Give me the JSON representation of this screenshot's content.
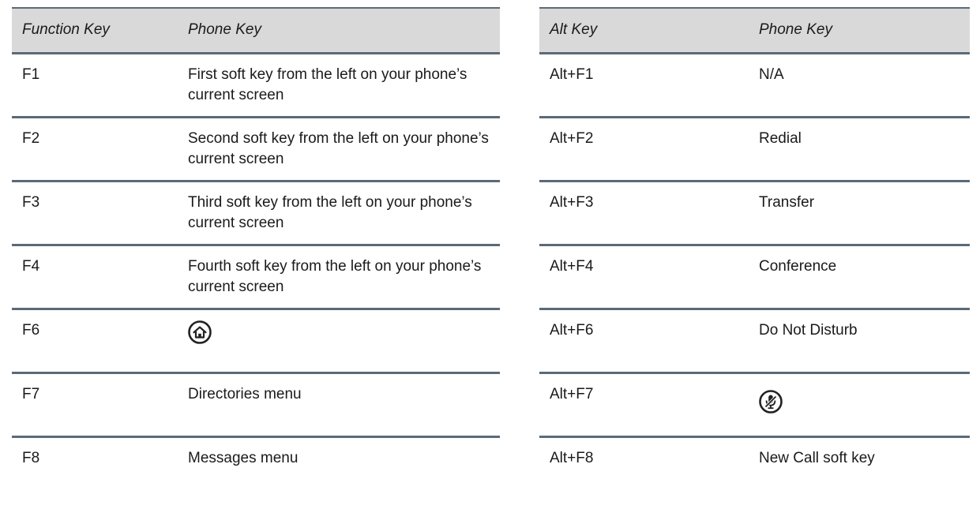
{
  "left_table": {
    "headers": [
      "Function Key",
      "Phone Key"
    ],
    "rows": [
      {
        "key": "F1",
        "value": "First soft key from the left on your phone’s current screen"
      },
      {
        "key": "F2",
        "value": "Second soft key from the left on your phone’s current screen"
      },
      {
        "key": "F3",
        "value": "Third soft key from the left on your phone’s current screen"
      },
      {
        "key": "F4",
        "value": "Fourth soft key from the left on your phone’s current screen"
      },
      {
        "key": "F6",
        "value": "",
        "icon": "home-icon"
      },
      {
        "key": "F7",
        "value": "Directories menu"
      },
      {
        "key": "F8",
        "value": "Messages menu"
      }
    ]
  },
  "right_table": {
    "headers": [
      "Alt Key",
      "Phone Key"
    ],
    "rows": [
      {
        "key": "Alt+F1",
        "value": "N/A"
      },
      {
        "key": "Alt+F2",
        "value": "Redial"
      },
      {
        "key": "Alt+F3",
        "value": "Transfer"
      },
      {
        "key": "Alt+F4",
        "value": "Conference"
      },
      {
        "key": "Alt+F6",
        "value": "Do Not Disturb"
      },
      {
        "key": "Alt+F7",
        "value": "",
        "icon": "mute-microphone-icon"
      },
      {
        "key": "Alt+F8",
        "value": "New Call soft key"
      }
    ]
  },
  "colors": {
    "header_bg": "#d9d9d9",
    "rule": "#5b6a78",
    "text": "#1a1a1a"
  }
}
